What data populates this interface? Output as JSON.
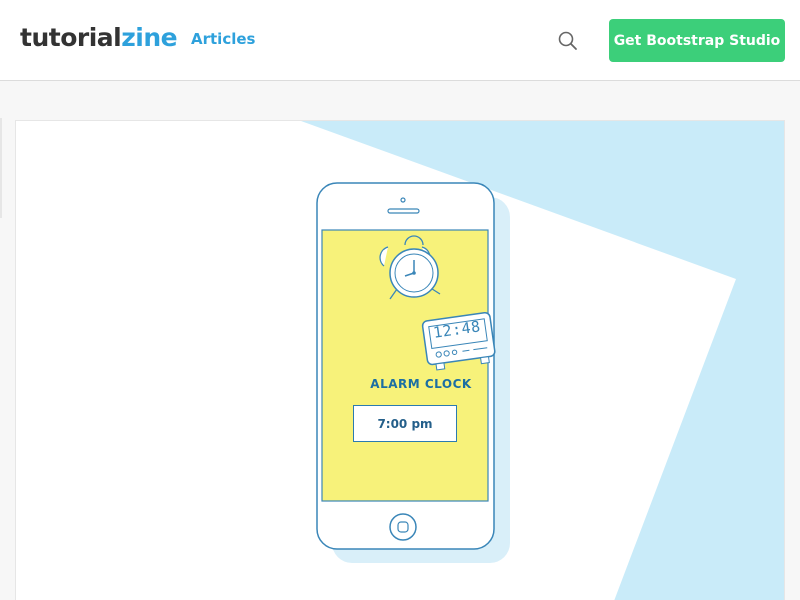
{
  "header": {
    "logo": {
      "part1": "tutorial",
      "part2": "zine"
    },
    "nav": {
      "articles": "Articles"
    },
    "search_icon": "search-icon",
    "cta_label": "Get Bootstrap Studio"
  },
  "hero": {
    "illustration": "alarm-clock-app-phone",
    "app_title": "ALARM CLOCK",
    "alarm_time": "7:00 pm",
    "digital_clock": "12:48"
  },
  "colors": {
    "accent": "#2ea1dc",
    "cta": "#3ccf7a",
    "sky": "#c9ebf9",
    "screen": "#f7f27a",
    "outline": "#3a86b8"
  }
}
